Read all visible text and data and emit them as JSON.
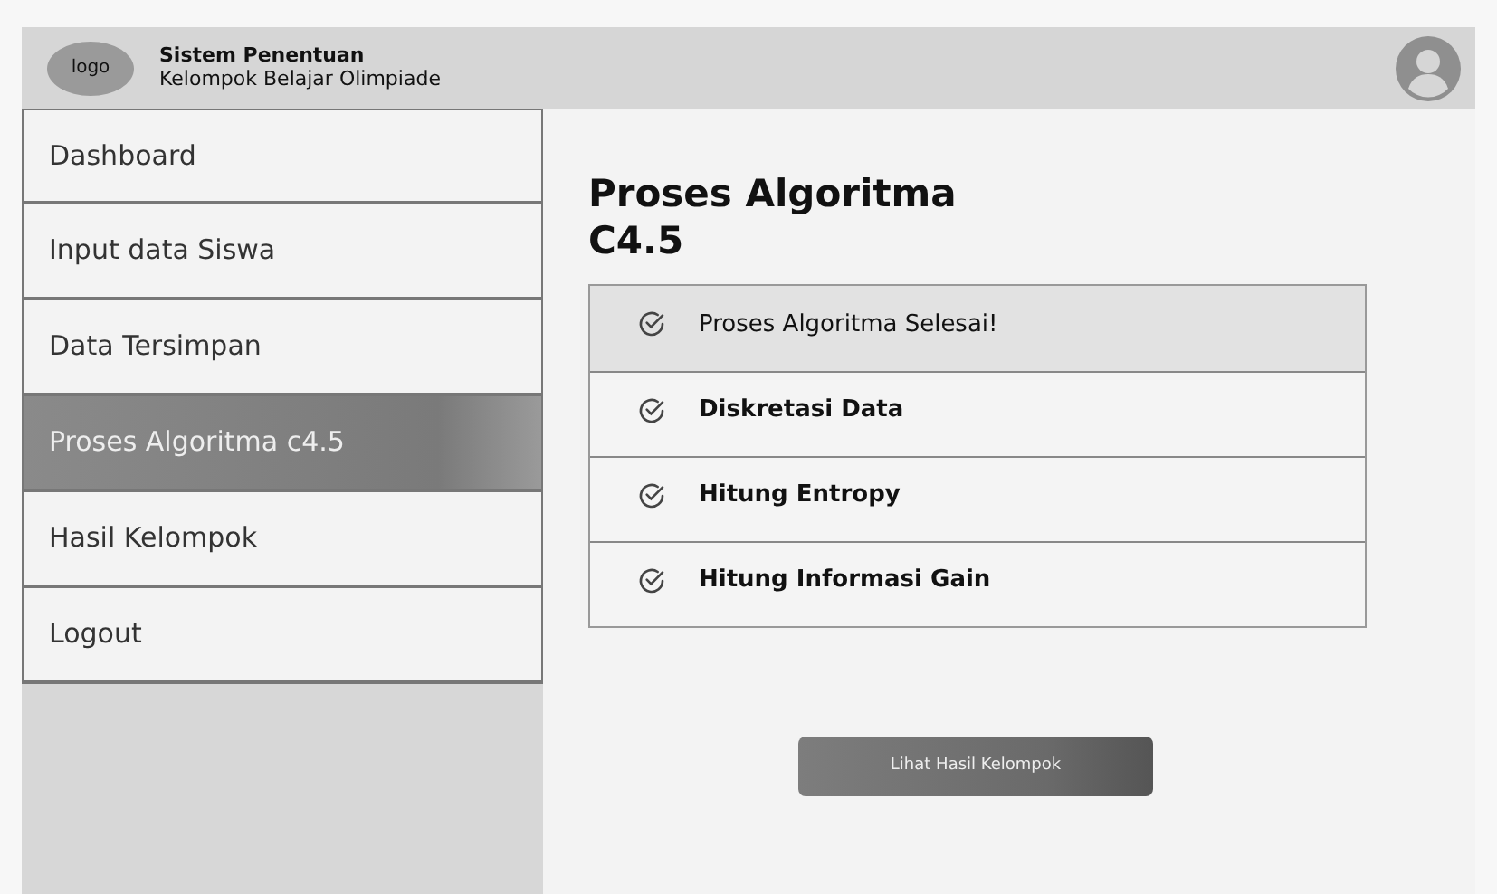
{
  "header": {
    "logo": "logo",
    "title": "Sistem Penentuan",
    "subtitle": "Kelompok Belajar Olimpiade"
  },
  "sidebar": {
    "items": [
      {
        "label": "Dashboard",
        "selected": false
      },
      {
        "label": "Input data Siswa",
        "selected": false
      },
      {
        "label": "Data Tersimpan",
        "selected": false
      },
      {
        "label": "Proses Algoritma c4.5",
        "selected": true
      },
      {
        "label": "Hasil Kelompok",
        "selected": false
      },
      {
        "label": "Logout",
        "selected": false
      }
    ]
  },
  "main": {
    "title": "Proses Algoritma C4.5",
    "steps": [
      {
        "label": "Proses Algoritma Selesai!",
        "selected": true
      },
      {
        "label": "Diskretasi Data",
        "selected": false
      },
      {
        "label": "Hitung Entropy",
        "selected": false
      },
      {
        "label": "Hitung Informasi Gain",
        "selected": false
      }
    ],
    "button": "Lihat Hasil Kelompok"
  }
}
